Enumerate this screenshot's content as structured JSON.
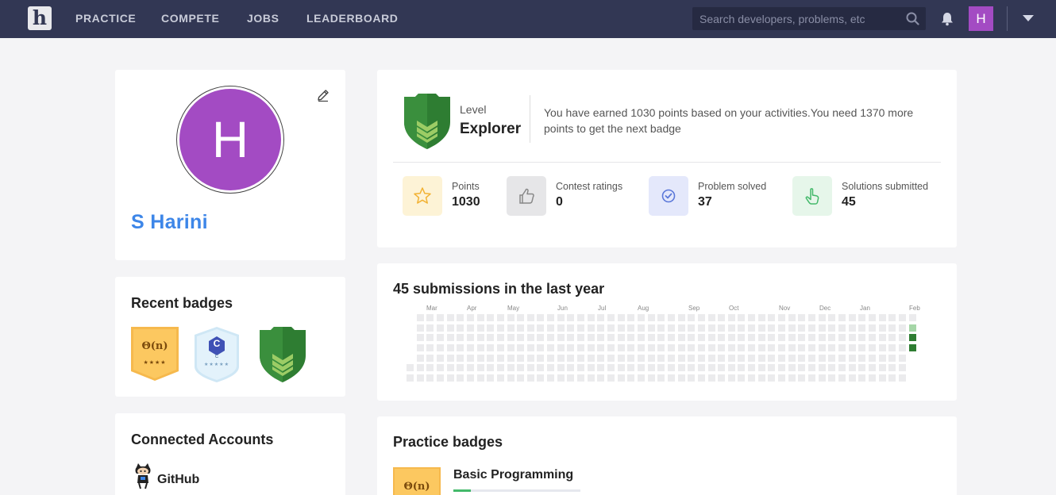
{
  "nav": {
    "logo_letter": "h",
    "links": [
      "PRACTICE",
      "COMPETE",
      "JOBS",
      "LEADERBOARD"
    ],
    "search_placeholder": "Search developers, problems, etc",
    "avatar_letter": "H"
  },
  "profile": {
    "avatar_letter": "H",
    "name": "S Harini",
    "avatar_color": "#a34bc3"
  },
  "level": {
    "label": "Level",
    "name": "Explorer",
    "message": "You have earned 1030 points based on your activities.You need 1370 more points to get the next badge",
    "stats": [
      {
        "label": "Points",
        "value": "1030",
        "icon": "star-icon"
      },
      {
        "label": "Contest ratings",
        "value": "0",
        "icon": "thumbs-up-icon"
      },
      {
        "label": "Problem solved",
        "value": "37",
        "icon": "check-circle-icon"
      },
      {
        "label": "Solutions submitted",
        "value": "45",
        "icon": "hand-pointer-icon"
      }
    ]
  },
  "recent_badges": {
    "title": "Recent badges",
    "badges": [
      {
        "text": "Θ(n)",
        "stars": "★★★★",
        "icon": "complexity-badge-icon"
      },
      {
        "text": "C",
        "caption": "C",
        "stars": "★★★★★",
        "icon": "c-language-badge-icon"
      },
      {
        "icon": "explorer-shield-badge-icon"
      }
    ]
  },
  "submissions": {
    "title": "45 submissions in the last year",
    "months": [
      "Mar",
      "Apr",
      "May",
      "Jun",
      "Jul",
      "Aug",
      "Sep",
      "Oct",
      "Nov",
      "Dec",
      "Jan",
      "Feb"
    ]
  },
  "accounts": {
    "title": "Connected Accounts",
    "items": [
      {
        "name": "GitHub",
        "icon": "github-octocat-icon"
      }
    ]
  },
  "practice": {
    "title": "Practice badges",
    "items": [
      {
        "name": "Basic Programming",
        "badge_text": "Θ(n)"
      }
    ]
  },
  "colors": {
    "nav_bg": "#323754",
    "accent_blue": "#3d86e8",
    "green_dark": "#2e7d32",
    "green_light": "#a5d6a7"
  }
}
